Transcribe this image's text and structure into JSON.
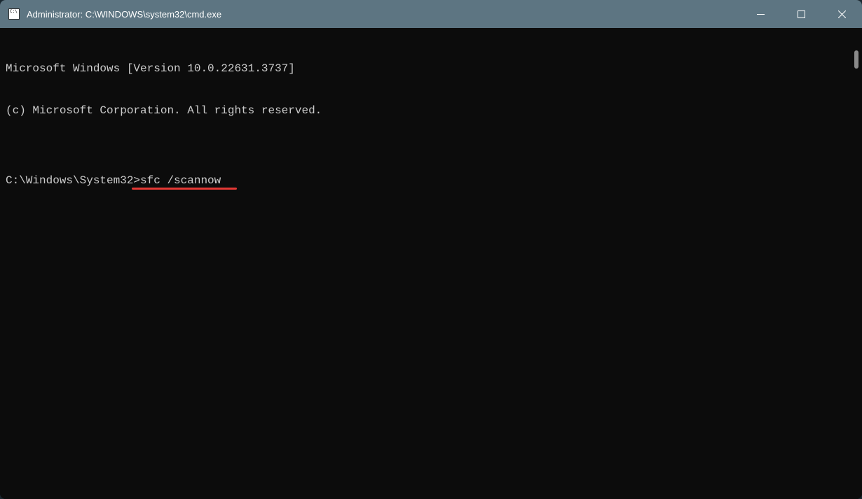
{
  "titlebar": {
    "title": "Administrator: C:\\WINDOWS\\system32\\cmd.exe"
  },
  "terminal": {
    "line1": "Microsoft Windows [Version 10.0.22631.3737]",
    "line2": "(c) Microsoft Corporation. All rights reserved.",
    "blank": "",
    "prompt": "C:\\Windows\\System32>",
    "command": "sfc /scannow"
  },
  "annotation": {
    "underline_color": "#e53935"
  }
}
